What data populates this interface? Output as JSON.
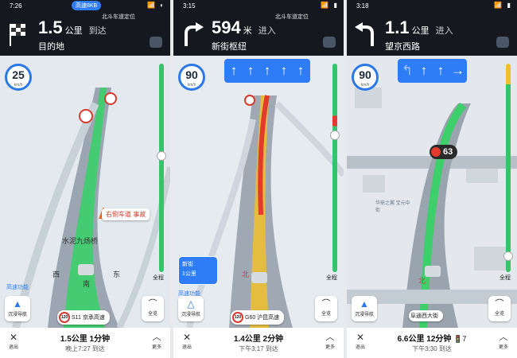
{
  "colors": {
    "header_bg": "#15181e",
    "route_green": "#34c46b",
    "accent_blue": "#2f7df6",
    "incident_red": "#d93a2e"
  },
  "panels": [
    {
      "status": {
        "time": "7:26",
        "pill": "高速8KB",
        "gps": "北斗车道定位",
        "indicators": "📶 ◐"
      },
      "turn_icon": "finish-flag-icon",
      "distance": "1.5",
      "unit": "公里",
      "action": "到达",
      "road": "目的地",
      "speed_limit": "25",
      "speed_unit": "km/h",
      "route_progress": 0.42,
      "incident": "右侧车道 事故",
      "map_labels": [
        "水泥九炀桥",
        "西",
        "南",
        "东",
        "高速功能"
      ],
      "whole_label": "全程",
      "immersive_label": "沉浸导航",
      "fullview_label": "全览",
      "road_sign": {
        "limit": "120",
        "name": "S11 京承高速"
      },
      "bottom": {
        "exit": "退出",
        "main": "1.5公里 1分钟",
        "sub": "晚上7:27 到达",
        "more": "更多"
      }
    },
    {
      "status": {
        "time": "3:15",
        "gps": "北斗车道定位",
        "indicators": "📶 ▮"
      },
      "turn_icon": "turn-right-icon",
      "distance": "594",
      "unit": "米",
      "action": "进入",
      "road": "新街枢纽",
      "speed_limit": "90",
      "speed_unit": "km/h",
      "route_progress": 0.33,
      "lanes": [
        {
          "arrow": "↑",
          "active": true
        },
        {
          "arrow": "↑",
          "active": true
        },
        {
          "arrow": "↑",
          "active": true
        },
        {
          "arrow": "↑",
          "active": true
        },
        {
          "arrow": "↑",
          "active": true
        }
      ],
      "guide": {
        "line1": "新街",
        "line2": "1公里"
      },
      "map_labels": [
        "北",
        "高速功能"
      ],
      "whole_label": "全程",
      "immersive_label": "沉浸导航",
      "fullview_label": "全览",
      "road_sign": {
        "limit": "120",
        "name": "G60 沪昆高速"
      },
      "bottom": {
        "exit": "退出",
        "main": "1.4公里 2分钟",
        "sub": "下午3:17 到达",
        "more": "更多"
      }
    },
    {
      "status": {
        "time": "3:18",
        "gps": "",
        "indicators": "📶 ▮"
      },
      "turn_icon": "turn-left-icon",
      "distance": "1.1",
      "unit": "公里",
      "action": "进入",
      "road": "望京西路",
      "speed_limit": "90",
      "speed_unit": "km/h",
      "route_progress": 0.72,
      "lanes": [
        {
          "arrow": "↰",
          "active": false
        },
        {
          "arrow": "↑",
          "active": true
        },
        {
          "arrow": "↑",
          "active": true
        },
        {
          "arrow": "→",
          "active": true
        }
      ],
      "traffic_light": "63",
      "map_labels": [
        "华鼎之翼 宝元中街",
        "北"
      ],
      "whole_label": "全程",
      "immersive_label": "沉浸导航",
      "fullview_label": "全览",
      "road_sign": {
        "name": "阜通西大街"
      },
      "bottom": {
        "exit": "退出",
        "main": "6.6公里 12分钟",
        "sub": "下午3:30 到达",
        "more": "更多",
        "lights": "🚦7"
      }
    }
  ]
}
